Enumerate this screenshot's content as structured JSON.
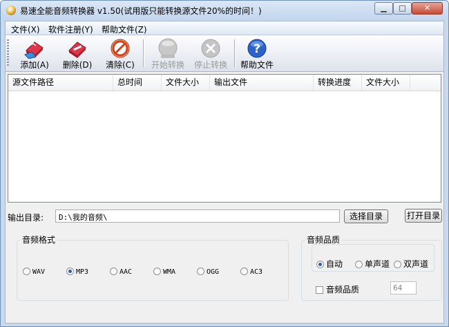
{
  "window": {
    "title": "易速全能音频转换器 v1.50(试用版只能转换源文件20%的时间！)"
  },
  "menu": {
    "items": [
      "文件(X)",
      "软件注册(Y)",
      "帮助文件(Z)"
    ]
  },
  "toolbar": {
    "add": "添加(A)",
    "delete": "删除(D)",
    "clear": "清除(C)",
    "start": "开始转换",
    "stop": "停止转换",
    "help": "帮助文件"
  },
  "file_list": {
    "columns": [
      "源文件路径",
      "总时间",
      "文件大小",
      "输出文件",
      "转换进度",
      "文件大小"
    ],
    "rows": []
  },
  "output": {
    "label": "输出目录:",
    "value": "D:\\我的音频\\",
    "choose_button": "选择目录",
    "open_button": "打开目录"
  },
  "format": {
    "title": "音频格式",
    "options": [
      "WAV",
      "MP3",
      "AAC",
      "WMA",
      "OGG",
      "AC3"
    ],
    "selected": "MP3"
  },
  "quality": {
    "title": "音频品质",
    "options": [
      "自动",
      "单声道",
      "双声道"
    ],
    "selected": "自动",
    "checkbox_label": "音频品质",
    "value": "64"
  }
}
